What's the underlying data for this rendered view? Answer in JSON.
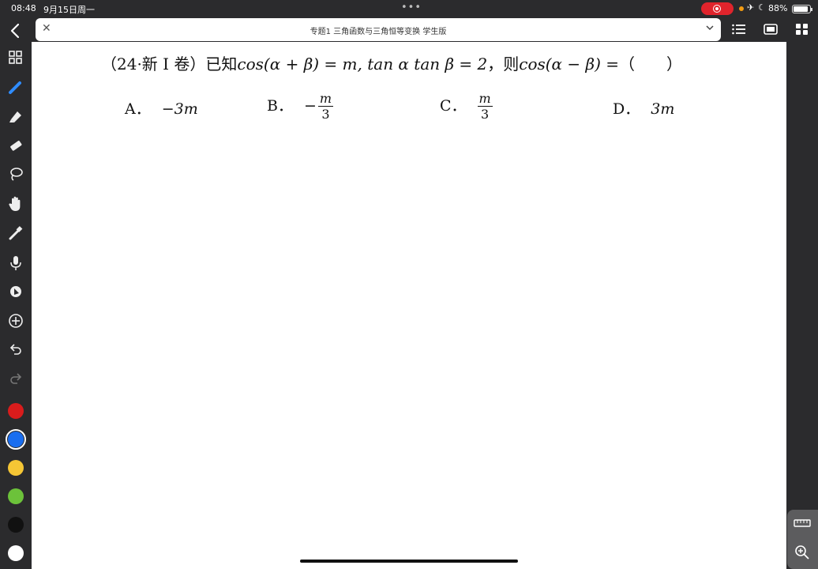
{
  "status": {
    "time": "08:48",
    "date": "9月15日周一",
    "battery": "88%",
    "battery_level": 0.88,
    "record_color": "#e0242c"
  },
  "titlebar": {
    "title": "专题1 三角函数与三角恒等变换 学生版"
  },
  "icons": {
    "back": "chevron-left-icon",
    "close": "close-icon",
    "dropdown": "chevron-down-icon",
    "list": "list-icon",
    "window": "window-icon",
    "grid": "grid-icon"
  },
  "tools": [
    "grid-icon",
    "pen-icon",
    "highlighter-icon",
    "eraser-icon",
    "lasso-icon",
    "hand-icon",
    "marker-icon",
    "mic-icon",
    "shape-icon",
    "add-icon",
    "undo-icon",
    "redo-icon"
  ],
  "colors": [
    "#d91c1c",
    "#1a6ef0",
    "#f5c635",
    "#6cc23a",
    "#111111",
    "#ffffff"
  ],
  "selected_color": "#1a6ef0",
  "document": {
    "question_prefix": "（24·新 I 卷）已知",
    "question_expr1": "cos(α + β) = m, tan α tan β = 2",
    "question_mid": "，则",
    "question_expr2": "cos(α − β) =",
    "question_blank": "（　　）",
    "options": [
      {
        "label": "A．",
        "value": "−3m"
      },
      {
        "label": "B．",
        "sign": "−",
        "num": "m",
        "den": "3"
      },
      {
        "label": "C．",
        "num": "m",
        "den": "3"
      },
      {
        "label": "D．",
        "value": "3m"
      }
    ]
  }
}
